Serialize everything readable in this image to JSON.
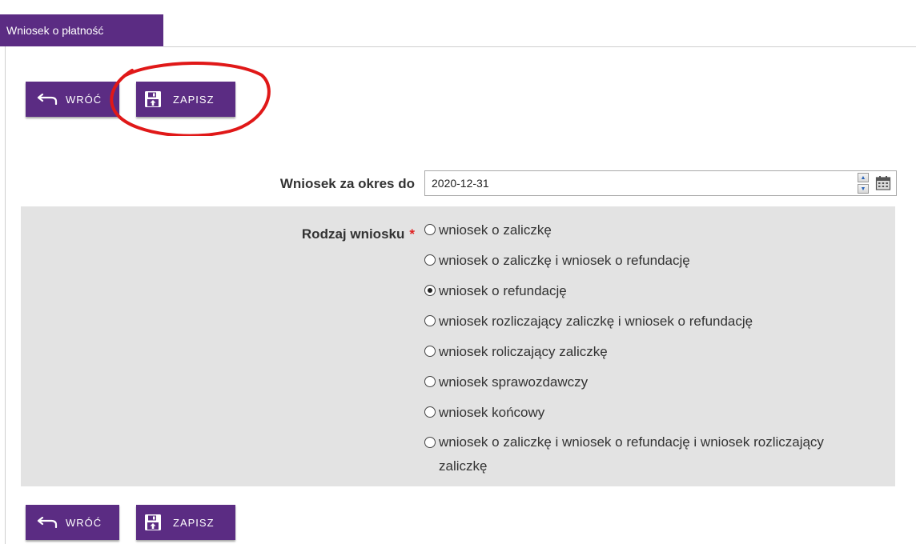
{
  "tab": {
    "label": "Wniosek o płatność"
  },
  "toolbar_top": {
    "back_label": "WRÓĆ",
    "save_label": "ZAPISZ"
  },
  "form": {
    "date_label": "Wniosek za okres do",
    "date_value": "2020-12-31",
    "kind_label": "Rodzaj wniosku",
    "required_mark": "*",
    "options": [
      {
        "label": "wniosek o zaliczkę",
        "checked": false
      },
      {
        "label": "wniosek o zaliczkę i wniosek o refundację",
        "checked": false
      },
      {
        "label": "wniosek o refundację",
        "checked": true
      },
      {
        "label": "wniosek rozliczający zaliczkę i wniosek o refundację",
        "checked": false
      },
      {
        "label": "wniosek roliczający zaliczkę",
        "checked": false
      },
      {
        "label": "wniosek sprawozdawczy",
        "checked": false
      },
      {
        "label": "wniosek końcowy",
        "checked": false
      },
      {
        "label": "wniosek o zaliczkę i wniosek o refundację i wniosek rozliczający zaliczkę",
        "checked": false
      }
    ]
  },
  "toolbar_bottom": {
    "back_label": "WRÓĆ",
    "save_label": "ZAPISZ"
  },
  "icons": {
    "back": "back-arrow-icon",
    "save": "save-floppy-icon",
    "calendar": "calendar-icon",
    "spinner_up": "spinner-up-icon",
    "spinner_down": "spinner-down-icon"
  },
  "colors": {
    "primary": "#5b2c83",
    "panel": "#e3e3e3",
    "required": "#e02020",
    "annotation": "#e01818"
  }
}
